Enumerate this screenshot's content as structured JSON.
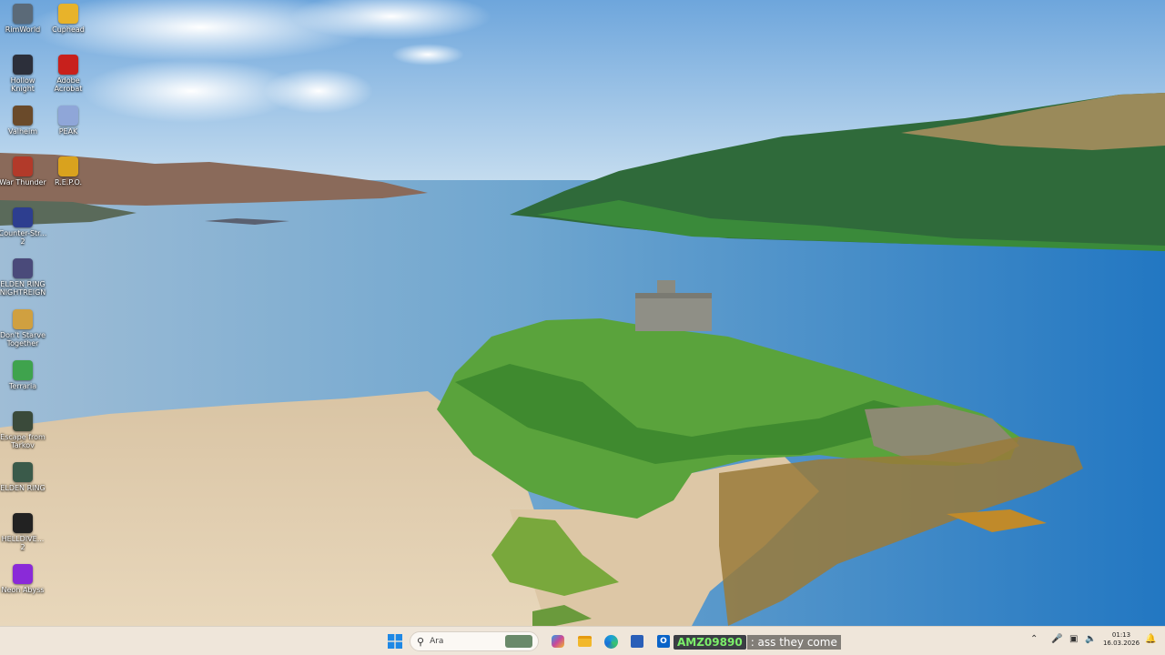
{
  "desktop": {
    "icons": [
      {
        "label": "RimWorld",
        "icon": "rimworld-icon",
        "color": "#5b6a78"
      },
      {
        "label": "Cuphead",
        "icon": "cuphead-icon",
        "color": "#e8b32a"
      },
      {
        "label": "Hollow Knight",
        "icon": "hollow-knight-icon",
        "color": "#2c2f3a"
      },
      {
        "label": "Adobe Acrobat",
        "icon": "adobe-acrobat-icon",
        "color": "#c8201c"
      },
      {
        "label": "Valheim",
        "icon": "valheim-icon",
        "color": "#6a4a2a"
      },
      {
        "label": "PEAK",
        "icon": "peak-icon",
        "color": "#8fa6d8"
      },
      {
        "label": "War Thunder",
        "icon": "war-thunder-icon",
        "color": "#b23a2a"
      },
      {
        "label": "R.E.P.O.",
        "icon": "repo-icon",
        "color": "#d9a21e"
      },
      {
        "label": "Counter-Str... 2",
        "icon": "counter-strike-icon",
        "color": "#2d3e8f"
      },
      {
        "label": "ELDEN RING NIGHTREIGN",
        "icon": "elden-ring-nightreign-icon",
        "color": "#4a4a7a"
      },
      {
        "label": "Don't Starve Together",
        "icon": "dont-starve-icon",
        "color": "#d0a040"
      },
      {
        "label": "Terraria",
        "icon": "terraria-icon",
        "color": "#3fa34d"
      },
      {
        "label": "Escape from Tarkov",
        "icon": "tarkov-icon",
        "color": "#3a4a3a"
      },
      {
        "label": "ELDEN RING",
        "icon": "elden-ring-icon",
        "color": "#3a5a4a"
      },
      {
        "label": "HELLDIVE... 2",
        "icon": "helldivers-icon",
        "color": "#222222"
      },
      {
        "label": "Neon Abyss",
        "icon": "neon-abyss-icon",
        "color": "#8a2ad8"
      }
    ]
  },
  "taskbar": {
    "search_placeholder": "Ara",
    "apps": [
      {
        "icon": "windows-start-icon",
        "color": "#1e88e5"
      },
      {
        "icon": "widgets-icon",
        "color": "#6a8a6a"
      },
      {
        "icon": "copilot-icon",
        "color": "#c9489a"
      },
      {
        "icon": "file-explorer-icon",
        "color": "#f2b82a"
      },
      {
        "icon": "edge-icon",
        "color": "#1a9fd8"
      },
      {
        "icon": "store-icon",
        "color": "#2a5fb8"
      },
      {
        "icon": "outlook-icon",
        "color": "#0a64c8"
      }
    ],
    "overlay": {
      "user": "AMZ09890",
      "message": ": ass they come"
    },
    "clock": {
      "time": "01:13",
      "date": "16.03.2026"
    }
  },
  "colors": {
    "taskbar_bg": "#efe6da",
    "accent": "#1e88e5",
    "overlay_user": "#7cf06a"
  }
}
